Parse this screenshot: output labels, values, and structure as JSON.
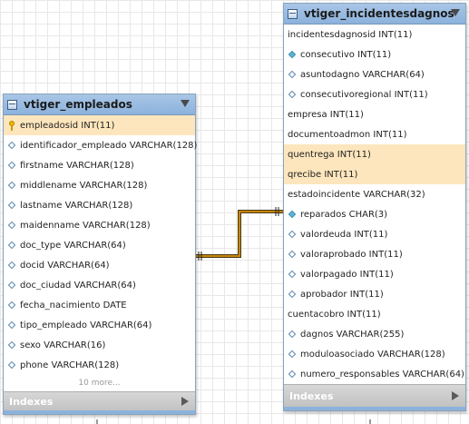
{
  "tables": [
    {
      "name": "vtiger_empleados",
      "columns": [
        {
          "icon": "key-icon",
          "text": "empleadosid INT(11)",
          "highlight": true
        },
        {
          "icon": "diamond-icon",
          "text": "identificador_empleado VARCHAR(128)",
          "highlight": false
        },
        {
          "icon": "diamond-icon",
          "text": "firstname VARCHAR(128)",
          "highlight": false
        },
        {
          "icon": "diamond-icon",
          "text": "middlename VARCHAR(128)",
          "highlight": false
        },
        {
          "icon": "diamond-icon",
          "text": "lastname VARCHAR(128)",
          "highlight": false
        },
        {
          "icon": "diamond-icon",
          "text": "maidenname VARCHAR(128)",
          "highlight": false
        },
        {
          "icon": "diamond-icon",
          "text": "doc_type VARCHAR(64)",
          "highlight": false
        },
        {
          "icon": "diamond-icon",
          "text": "docid VARCHAR(64)",
          "highlight": false
        },
        {
          "icon": "diamond-icon",
          "text": "doc_ciudad VARCHAR(64)",
          "highlight": false
        },
        {
          "icon": "diamond-icon",
          "text": "fecha_nacimiento DATE",
          "highlight": false
        },
        {
          "icon": "diamond-icon",
          "text": "tipo_empleado VARCHAR(64)",
          "highlight": false
        },
        {
          "icon": "diamond-icon",
          "text": "sexo VARCHAR(16)",
          "highlight": false
        },
        {
          "icon": "diamond-icon",
          "text": "phone VARCHAR(128)",
          "highlight": false
        }
      ],
      "more_label": "10 more...",
      "indexes_label": "Indexes"
    },
    {
      "name": "vtiger_incidentesdagnos",
      "columns": [
        {
          "icon": "none",
          "text": "incidentesdagnosid INT(11)",
          "highlight": false
        },
        {
          "icon": "filled-diamond-icon",
          "text": "consecutivo INT(11)",
          "highlight": false
        },
        {
          "icon": "diamond-icon",
          "text": "asuntodagno VARCHAR(64)",
          "highlight": false
        },
        {
          "icon": "diamond-icon",
          "text": "consecutivoregional INT(11)",
          "highlight": false
        },
        {
          "icon": "none",
          "text": "empresa INT(11)",
          "highlight": false
        },
        {
          "icon": "none",
          "text": "documentoadmon INT(11)",
          "highlight": false
        },
        {
          "icon": "none",
          "text": "quentrega INT(11)",
          "highlight": true
        },
        {
          "icon": "none",
          "text": "qrecibe INT(11)",
          "highlight": true
        },
        {
          "icon": "none",
          "text": "estadoincidente VARCHAR(32)",
          "highlight": false
        },
        {
          "icon": "filled-diamond-icon",
          "text": "reparados CHAR(3)",
          "highlight": false
        },
        {
          "icon": "diamond-icon",
          "text": "valordeuda INT(11)",
          "highlight": false
        },
        {
          "icon": "diamond-icon",
          "text": "valoraprobado INT(11)",
          "highlight": false
        },
        {
          "icon": "diamond-icon",
          "text": "valorpagado INT(11)",
          "highlight": false
        },
        {
          "icon": "diamond-icon",
          "text": "aprobador INT(11)",
          "highlight": false
        },
        {
          "icon": "none",
          "text": "cuentacobro INT(11)",
          "highlight": false
        },
        {
          "icon": "diamond-icon",
          "text": "dagnos VARCHAR(255)",
          "highlight": false
        },
        {
          "icon": "diamond-icon",
          "text": "moduloasociado VARCHAR(128)",
          "highlight": false
        },
        {
          "icon": "diamond-icon",
          "text": "numero_responsables VARCHAR(64)",
          "highlight": false
        }
      ],
      "more_label": "",
      "indexes_label": "Indexes"
    }
  ],
  "relationship": {
    "color": "#c8860a"
  }
}
